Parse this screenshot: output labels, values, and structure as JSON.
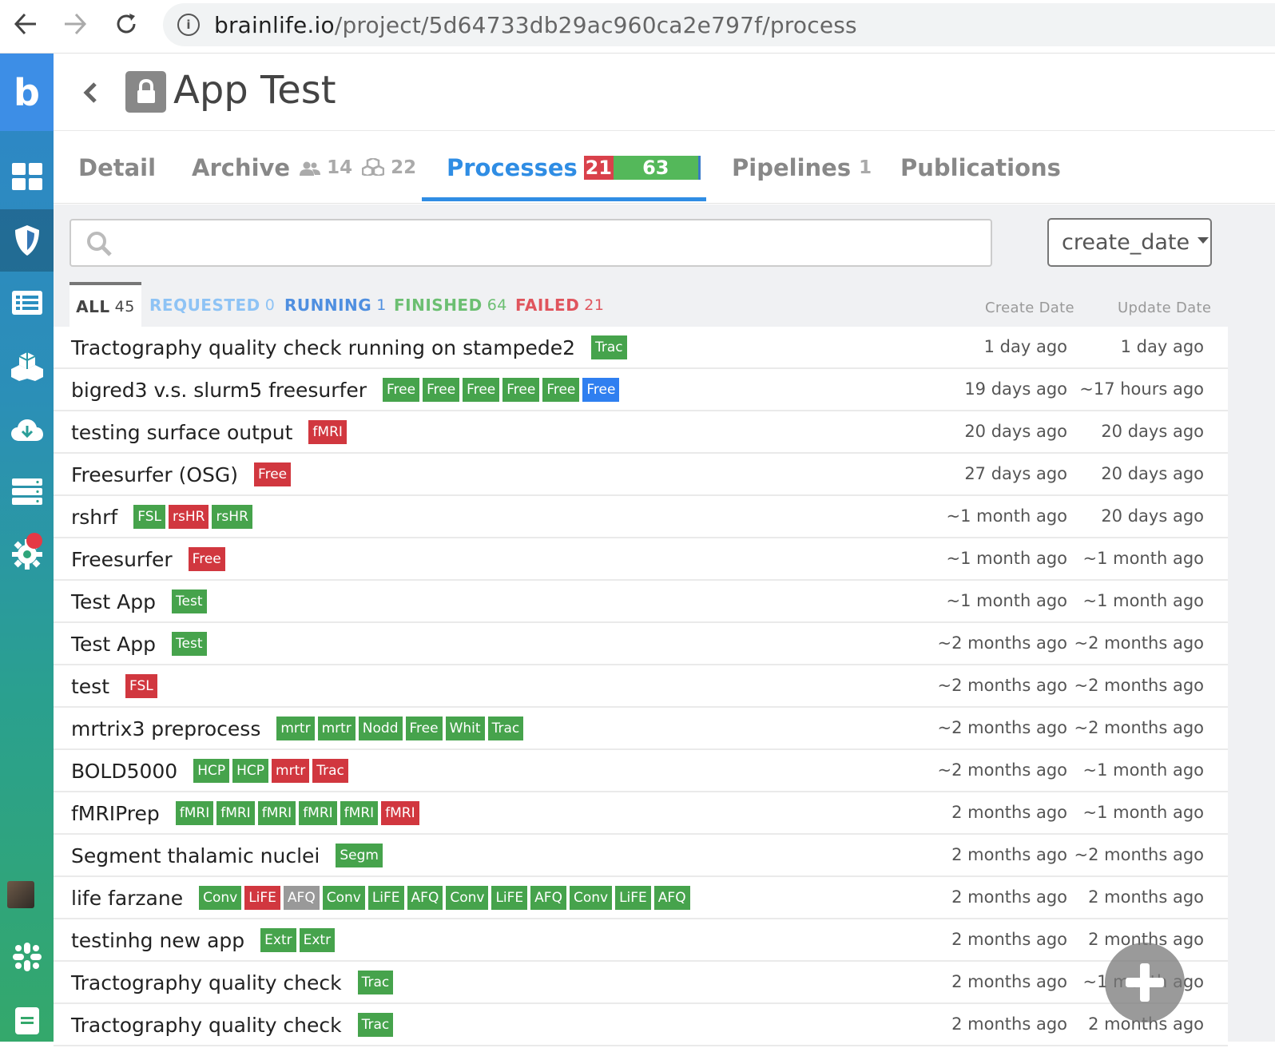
{
  "browser": {
    "url_host": "brainlife.io",
    "url_path": "/project/5d64733db29ac960ca2e797f/process"
  },
  "sidebar": {
    "logo": "b"
  },
  "header": {
    "title": "App Test"
  },
  "tabs": {
    "detail": "Detail",
    "archive": "Archive",
    "archive_users": "14",
    "archive_datasets": "22",
    "processes": "Processes",
    "processes_failed": "21",
    "processes_finished": "63",
    "pipelines": "Pipelines",
    "pipelines_count": "1",
    "publications": "Publications"
  },
  "sort": {
    "selected": "create_date"
  },
  "filters": {
    "all": {
      "label": "ALL",
      "count": "45"
    },
    "requested": {
      "label": "REQUESTED",
      "count": "0"
    },
    "running": {
      "label": "RUNNING",
      "count": "1"
    },
    "finished": {
      "label": "FINISHED",
      "count": "64"
    },
    "failed": {
      "label": "FAILED",
      "count": "21"
    }
  },
  "columns": {
    "create": "Create Date",
    "update": "Update Date"
  },
  "colors": {
    "primary": "#2f8de4",
    "requested": "#8ec3f5",
    "running": "#4f8fe0",
    "finished": "#6cbf72",
    "failed": "#e0555d"
  },
  "processes": [
    {
      "name": "Tractography quality check running on stampede2",
      "tags": [
        [
          "Trac",
          "g"
        ]
      ],
      "created": "1 day ago",
      "updated": "1 day ago"
    },
    {
      "name": "bigred3 v.s. slurm5 freesurfer",
      "tags": [
        [
          "Free",
          "g"
        ],
        [
          "Free",
          "g"
        ],
        [
          "Free",
          "g"
        ],
        [
          "Free",
          "g"
        ],
        [
          "Free",
          "g"
        ],
        [
          "Free",
          "b"
        ]
      ],
      "created": "19 days ago",
      "updated": "~17 hours ago"
    },
    {
      "name": "testing surface output",
      "tags": [
        [
          "fMRI",
          "r"
        ]
      ],
      "created": "20 days ago",
      "updated": "20 days ago"
    },
    {
      "name": "Freesurfer (OSG)",
      "tags": [
        [
          "Free",
          "r"
        ]
      ],
      "created": "27 days ago",
      "updated": "20 days ago"
    },
    {
      "name": "rshrf",
      "tags": [
        [
          "FSL",
          "g"
        ],
        [
          "rsHR",
          "r"
        ],
        [
          "rsHR",
          "g"
        ]
      ],
      "created": "~1 month ago",
      "updated": "20 days ago"
    },
    {
      "name": "Freesurfer",
      "tags": [
        [
          "Free",
          "r"
        ]
      ],
      "created": "~1 month ago",
      "updated": "~1 month ago"
    },
    {
      "name": "Test App",
      "tags": [
        [
          "Test",
          "g"
        ]
      ],
      "created": "~1 month ago",
      "updated": "~1 month ago"
    },
    {
      "name": "Test App",
      "tags": [
        [
          "Test",
          "g"
        ]
      ],
      "created": "~2 months ago",
      "updated": "~2 months ago"
    },
    {
      "name": "test",
      "tags": [
        [
          "FSL",
          "r"
        ]
      ],
      "created": "~2 months ago",
      "updated": "~2 months ago"
    },
    {
      "name": "mrtrix3 preprocess",
      "tags": [
        [
          "mrtr",
          "g"
        ],
        [
          "mrtr",
          "g"
        ],
        [
          "Nodd",
          "g"
        ],
        [
          "Free",
          "g"
        ],
        [
          "Whit",
          "g"
        ],
        [
          "Trac",
          "g"
        ]
      ],
      "created": "~2 months ago",
      "updated": "~2 months ago"
    },
    {
      "name": "BOLD5000",
      "tags": [
        [
          "HCP",
          "g"
        ],
        [
          "HCP",
          "g"
        ],
        [
          "mrtr",
          "r"
        ],
        [
          "Trac",
          "r"
        ]
      ],
      "created": "~2 months ago",
      "updated": "~1 month ago"
    },
    {
      "name": "fMRIPrep",
      "tags": [
        [
          "fMRI",
          "g"
        ],
        [
          "fMRI",
          "g"
        ],
        [
          "fMRI",
          "g"
        ],
        [
          "fMRI",
          "g"
        ],
        [
          "fMRI",
          "g"
        ],
        [
          "fMRI",
          "r"
        ]
      ],
      "created": "2 months ago",
      "updated": "~1 month ago"
    },
    {
      "name": "Segment thalamic nuclei",
      "tags": [
        [
          "Segm",
          "g"
        ]
      ],
      "created": "2 months ago",
      "updated": "~2 months ago"
    },
    {
      "name": "life farzane",
      "tags": [
        [
          "Conv",
          "g"
        ],
        [
          "LiFE",
          "r"
        ],
        [
          "AFQ",
          "x"
        ],
        [
          "Conv",
          "g"
        ],
        [
          "LiFE",
          "g"
        ],
        [
          "AFQ",
          "g"
        ],
        [
          "Conv",
          "g"
        ],
        [
          "LiFE",
          "g"
        ],
        [
          "AFQ",
          "g"
        ],
        [
          "Conv",
          "g"
        ],
        [
          "LiFE",
          "g"
        ],
        [
          "AFQ",
          "g"
        ]
      ],
      "created": "2 months ago",
      "updated": "2 months ago"
    },
    {
      "name": "testinhg new app",
      "tags": [
        [
          "Extr",
          "g"
        ],
        [
          "Extr",
          "g"
        ]
      ],
      "created": "2 months ago",
      "updated": "2 months ago"
    },
    {
      "name": "Tractography quality check",
      "tags": [
        [
          "Trac",
          "g"
        ]
      ],
      "created": "2 months ago",
      "updated": "~1 month ago"
    },
    {
      "name": "Tractography quality check",
      "tags": [
        [
          "Trac",
          "g"
        ]
      ],
      "created": "2 months ago",
      "updated": "2 months ago"
    }
  ]
}
